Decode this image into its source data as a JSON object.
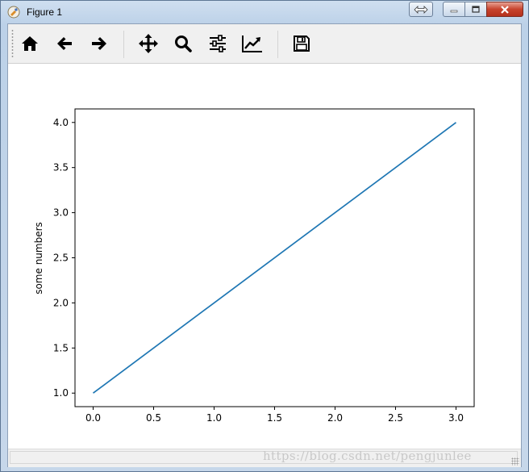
{
  "window": {
    "title": "Figure 1"
  },
  "toolbar": {
    "buttons": [
      {
        "name": "home",
        "icon": "home-icon"
      },
      {
        "name": "back",
        "icon": "arrow-left-icon"
      },
      {
        "name": "forward",
        "icon": "arrow-right-icon"
      },
      {
        "name": "pan",
        "icon": "move-arrows-icon"
      },
      {
        "name": "zoom",
        "icon": "magnifier-icon"
      },
      {
        "name": "subplots",
        "icon": "sliders-icon"
      },
      {
        "name": "customize",
        "icon": "line-chart-icon"
      },
      {
        "name": "save",
        "icon": "floppy-disk-icon"
      }
    ]
  },
  "status": {
    "text": ""
  },
  "watermark": {
    "text": "https://blog.csdn.net/pengjunlee"
  },
  "chart_data": {
    "type": "line",
    "x": [
      0,
      1,
      2,
      3
    ],
    "series": [
      {
        "values": [
          1,
          2,
          3,
          4
        ],
        "color": "#1f77b4"
      }
    ],
    "ylabel": "some numbers",
    "xlabel": "",
    "xlim": [
      -0.15,
      3.15
    ],
    "ylim": [
      0.85,
      4.15
    ],
    "xticks": [
      "0.0",
      "0.5",
      "1.0",
      "1.5",
      "2.0",
      "2.5",
      "3.0"
    ],
    "yticks": [
      "1.0",
      "1.5",
      "2.0",
      "2.5",
      "3.0",
      "3.5",
      "4.0"
    ],
    "grid": false
  }
}
